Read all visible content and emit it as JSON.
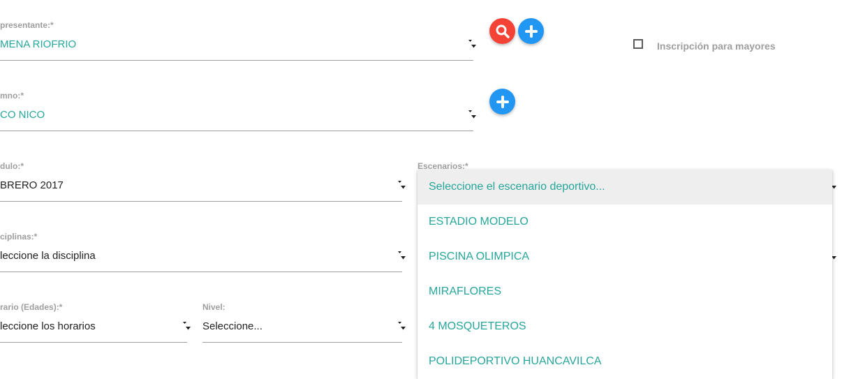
{
  "representante": {
    "label": "presentante:*",
    "value": "MENA RIOFRIO"
  },
  "alumno": {
    "label": "mno:*",
    "value": "CO NICO"
  },
  "modulo": {
    "label": "dulo:*",
    "value": "BRERO 2017"
  },
  "disciplinas": {
    "label": "ciplinas:*",
    "value": "leccione la disciplina"
  },
  "horario": {
    "label": "rario (Edades):*",
    "value": "leccione los horarios"
  },
  "nivel": {
    "label": "Nivel:",
    "value": "Seleccione..."
  },
  "escenarios": {
    "label": "Escenarios:*",
    "options": [
      "Seleccione el escenario deportivo...",
      "ESTADIO MODELO",
      "PISCINA OLIMPICA",
      "MIRAFLORES",
      "4 MOSQUETEROS",
      "POLIDEPORTIVO HUANCAVILCA"
    ]
  },
  "mayores_checkbox": {
    "label": "Inscripción para mayores",
    "checked": false
  },
  "icons": {
    "search": "search-icon",
    "add": "plus-icon",
    "caret": "caret-down-icon"
  },
  "colors": {
    "accent_teal": "#26a69a",
    "button_red": "#f44336",
    "button_blue": "#2196f3"
  }
}
